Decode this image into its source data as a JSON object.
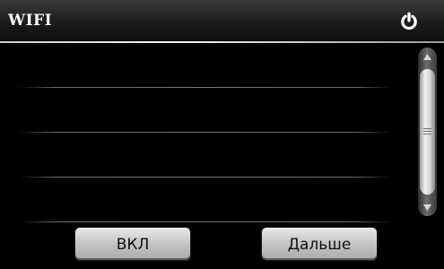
{
  "header": {
    "title": "WIFI",
    "power_icon": "power-icon"
  },
  "networks": [],
  "scrollbar": {
    "up_icon": "triangle-up-icon",
    "down_icon": "triangle-down-icon"
  },
  "buttons": {
    "on_label": "ВКЛ",
    "next_label": "Дальше"
  },
  "colors": {
    "background": "#000000",
    "header": "#2a2a2a",
    "divider": "#e6e6e6",
    "button": "#c8c8c8",
    "button_text": "#111111"
  }
}
